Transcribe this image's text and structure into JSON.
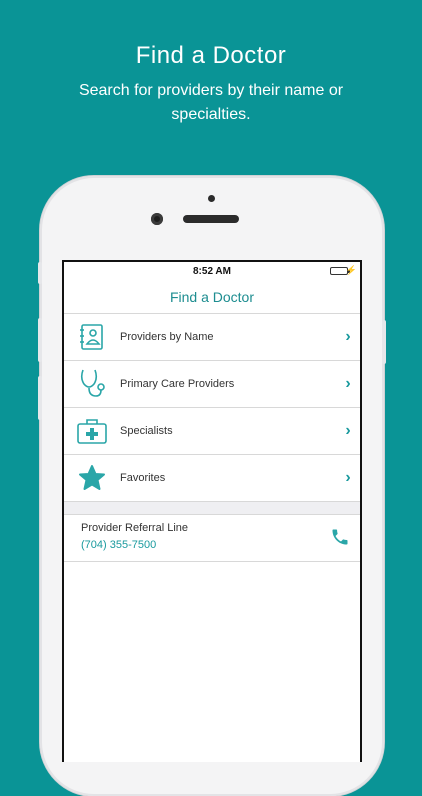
{
  "promo": {
    "title": "Find a Doctor",
    "subtitle": "Search for providers by their name or specialties."
  },
  "status_bar": {
    "time": "8:52 AM",
    "battery_level": 1.0
  },
  "nav": {
    "title": "Find a Doctor"
  },
  "menu": {
    "items": [
      {
        "label": "Providers by Name",
        "icon": "address-book-icon"
      },
      {
        "label": "Primary Care Providers",
        "icon": "stethoscope-icon"
      },
      {
        "label": "Specialists",
        "icon": "medical-kit-icon"
      },
      {
        "label": "Favorites",
        "icon": "star-icon"
      }
    ]
  },
  "referral": {
    "label": "Provider Referral Line",
    "phone": "(704) 355-7500",
    "icon": "phone-icon"
  },
  "colors": {
    "background": "#0a9496",
    "accent": "#1a9a9e",
    "icon": "#2aa6a8",
    "battery": "#3cc43c"
  }
}
